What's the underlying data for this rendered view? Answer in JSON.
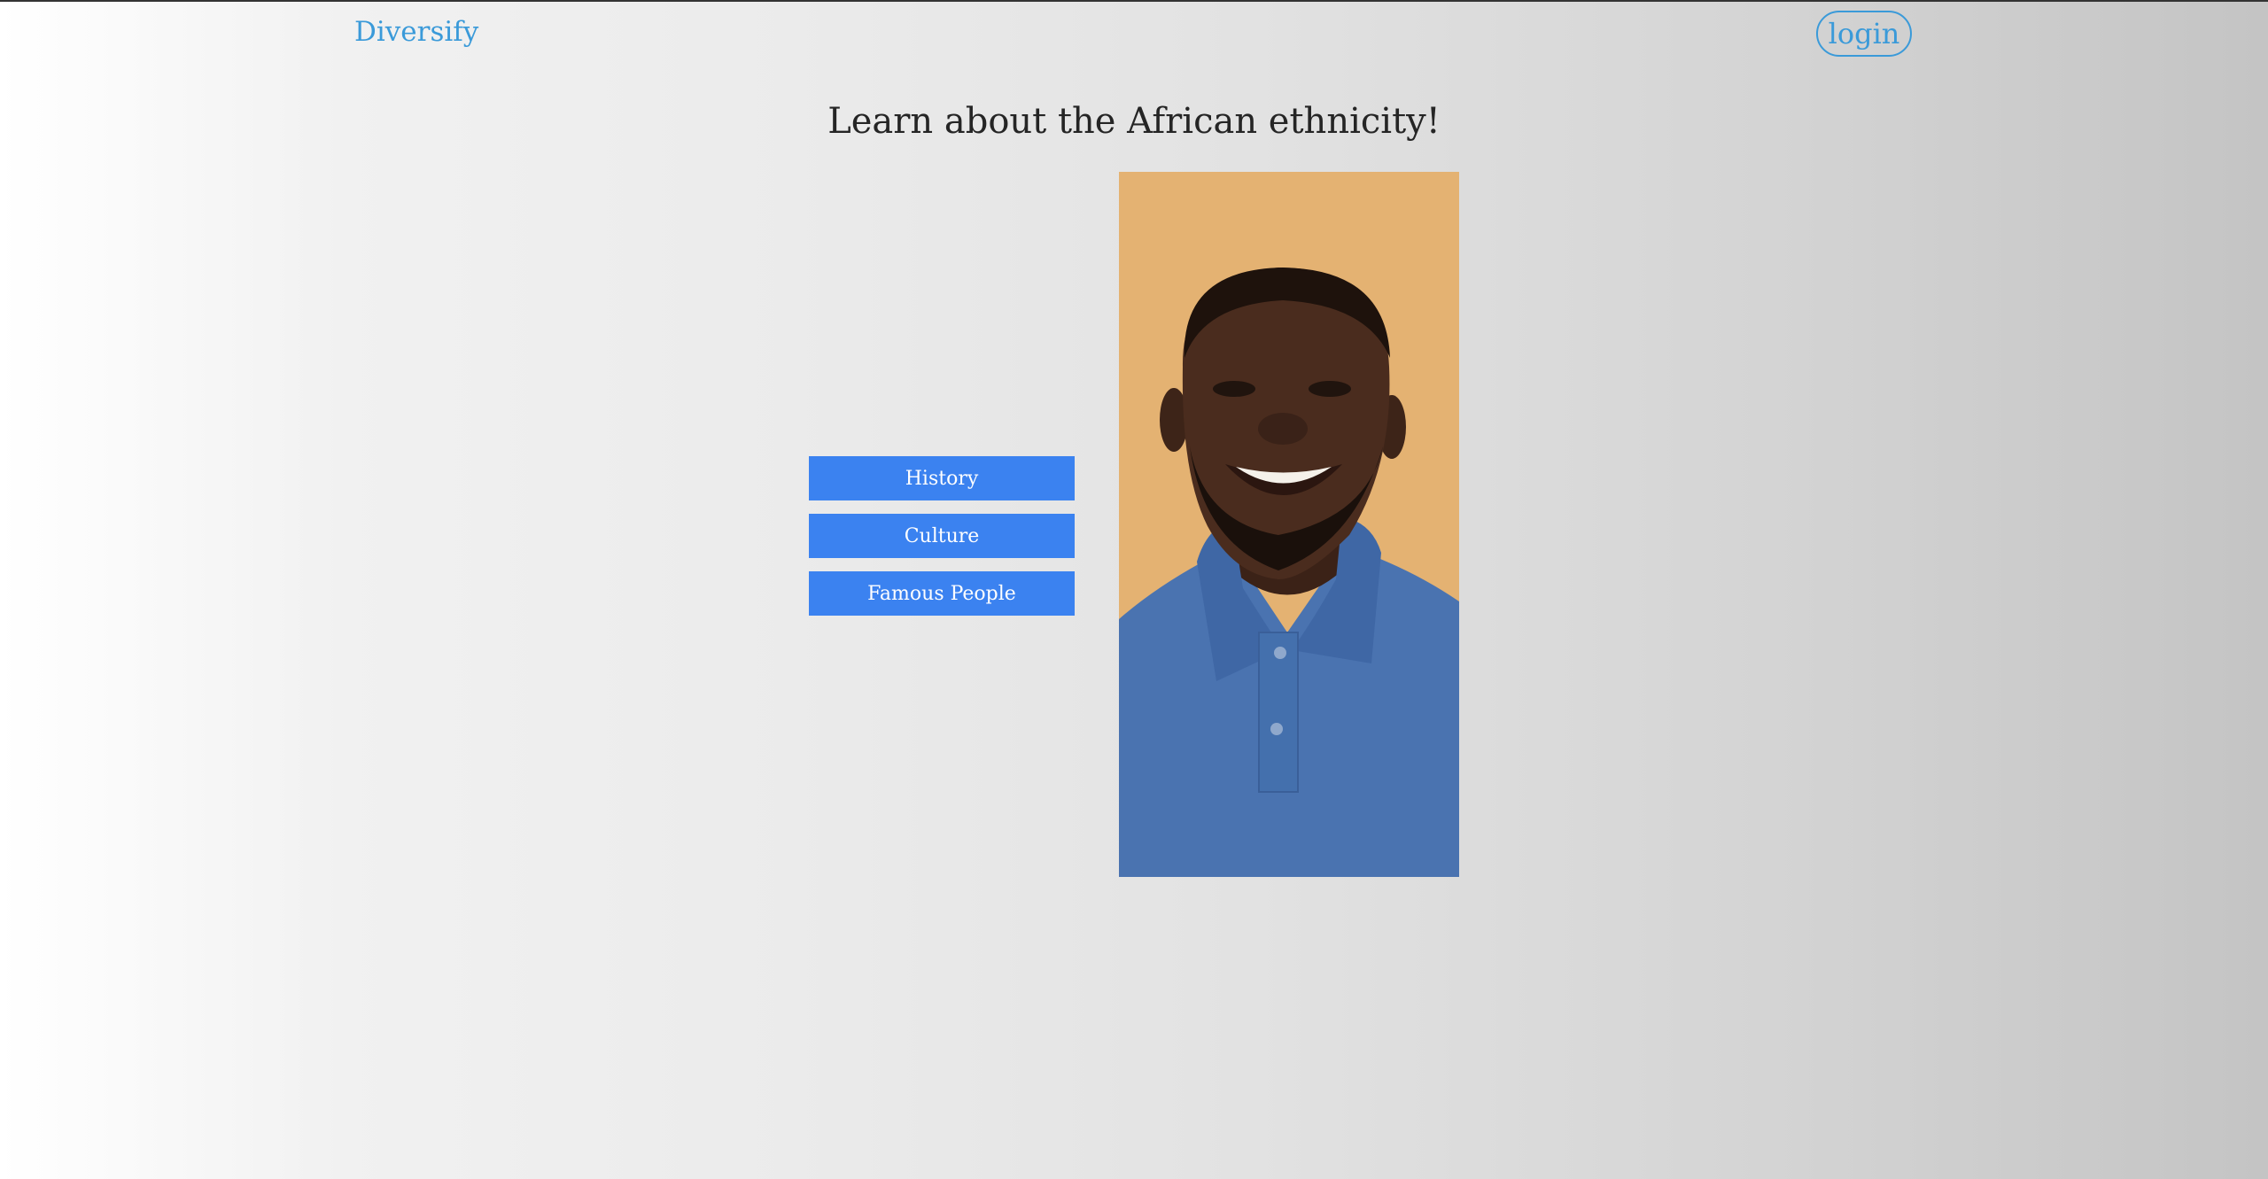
{
  "header": {
    "brand": "Diversify",
    "login_label": "login"
  },
  "main": {
    "title": "Learn about the African ethnicity!",
    "menu": [
      {
        "label": "History"
      },
      {
        "label": "Culture"
      },
      {
        "label": "Famous People"
      }
    ]
  },
  "colors": {
    "brand": "#3a9ad9",
    "button": "#3b82f0",
    "photo_background": "#e4b272",
    "shirt": "#4a73b0"
  }
}
